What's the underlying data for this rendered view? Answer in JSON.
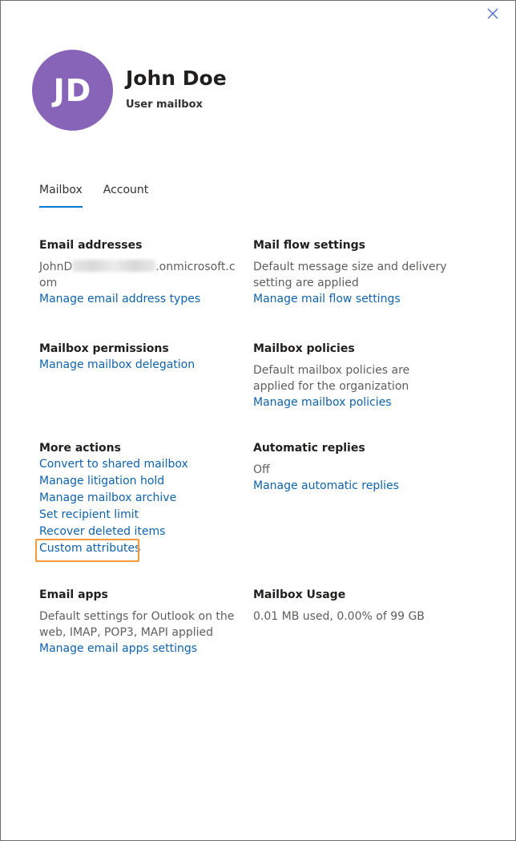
{
  "header": {
    "initials": "JD",
    "name": "John Doe",
    "mailbox_type": "User mailbox",
    "avatar_color": "#8764b8"
  },
  "close_icon": "close-icon",
  "tabs": [
    {
      "label": "Mailbox",
      "active": true
    },
    {
      "label": "Account",
      "active": false
    }
  ],
  "accent_color": "#0078d4",
  "link_color": "#0f62ab",
  "highlight_color": "#f59a3a",
  "sections": {
    "email_addresses": {
      "title": "Email addresses",
      "address_prefix": "JohnD",
      "address_suffix": ".onmicrosoft.com",
      "link": "Manage email address types"
    },
    "mail_flow": {
      "title": "Mail flow settings",
      "text": "Default message size and delivery setting are applied",
      "link": "Manage mail flow settings"
    },
    "mailbox_permissions": {
      "title": "Mailbox permissions",
      "link": "Manage mailbox delegation"
    },
    "mailbox_policies": {
      "title": "Mailbox policies",
      "text": "Default mailbox policies are applied for the organization",
      "link": "Manage mailbox policies"
    },
    "more_actions": {
      "title": "More actions",
      "links": [
        "Convert to shared mailbox",
        "Manage litigation hold",
        "Manage mailbox archive",
        "Set recipient limit",
        "Recover deleted items",
        "Custom attributes"
      ]
    },
    "automatic_replies": {
      "title": "Automatic replies",
      "status": "Off",
      "link": "Manage automatic replies"
    },
    "email_apps": {
      "title": "Email apps",
      "text": "Default settings for Outlook on the web, IMAP, POP3, MAPI applied",
      "link": "Manage email apps settings"
    },
    "mailbox_usage": {
      "title": "Mailbox Usage",
      "text": "0.01 MB used, 0.00% of 99 GB"
    }
  }
}
